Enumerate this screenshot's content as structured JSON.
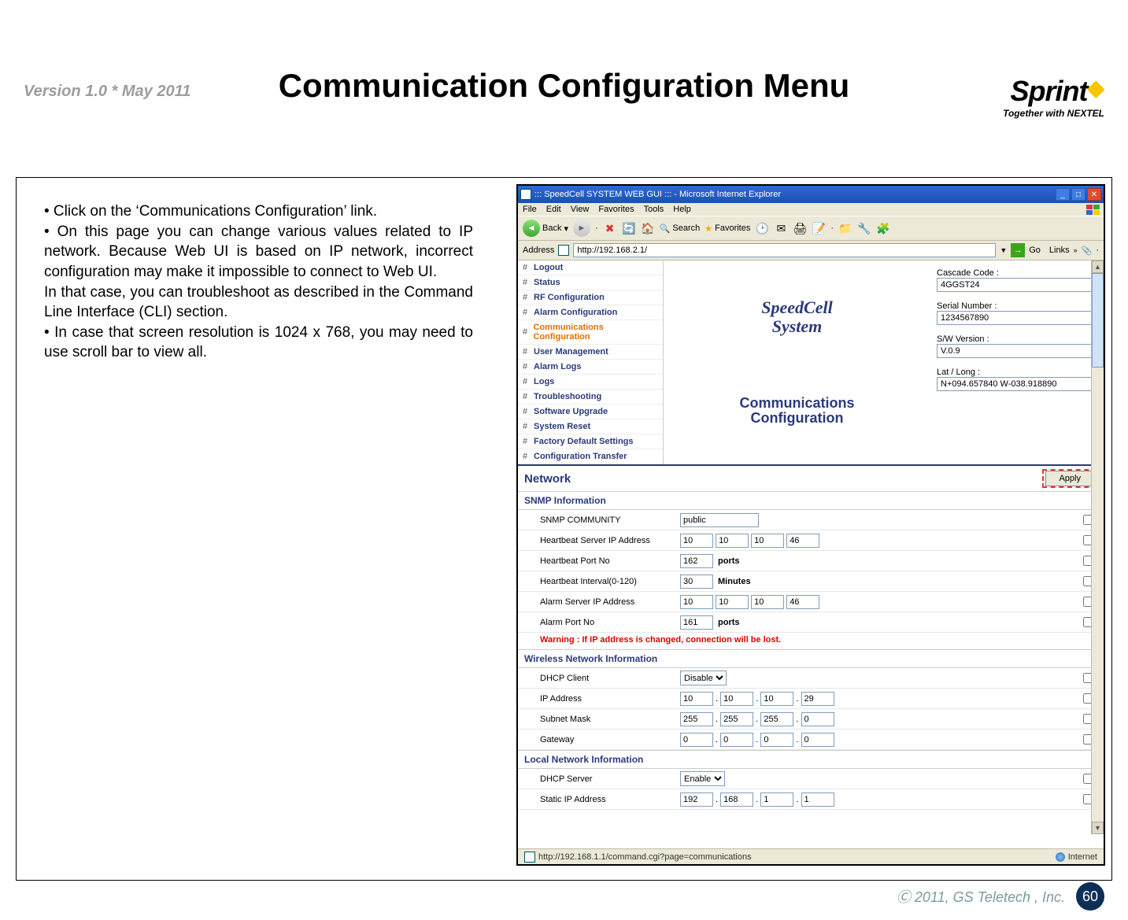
{
  "doc": {
    "version": "Version 1.0 * May 2011",
    "logo_main": "Sprint",
    "logo_sub_prefix": "Together with ",
    "logo_sub_brand": "NEXTEL",
    "title": "Communication Configuration Menu",
    "bullets_html": "• Click on the ‘Communications Configuration’ link.\n• On this page you can change various values related to IP network. Because Web UI is based on IP network, incorrect configuration may make it impossible to connect to Web UI.\nIn that case, you can troubleshoot as described in the Command Line Interface (CLI) section.\n• In case that screen resolution is 1024 x 768, you may need to use scroll bar to view all.",
    "footer_copy": "Ⓒ 2011, GS Teletech , Inc.",
    "page_number": "60"
  },
  "ie": {
    "title": "::: SpeedCell SYSTEM WEB GUI ::: - Microsoft Internet Explorer",
    "menus": [
      "File",
      "Edit",
      "View",
      "Favorites",
      "Tools",
      "Help"
    ],
    "back_label": "Back",
    "search_label": "Search",
    "fav_label": "Favorites",
    "address_label": "Address",
    "address_value": "http://192.168.2.1/",
    "go_label": "Go",
    "links_label": "Links",
    "status_url": "http://192.168.1.1/command.cgi?page=communications",
    "status_zone": "Internet"
  },
  "nav": {
    "items": [
      {
        "label": "Logout"
      },
      {
        "label": "Status"
      },
      {
        "label": "RF Configuration"
      },
      {
        "label": "Alarm Configuration"
      },
      {
        "label": "Communications Configuration",
        "active": true
      },
      {
        "label": "User Management"
      },
      {
        "label": "Alarm Logs"
      },
      {
        "label": "Logs"
      },
      {
        "label": "Troubleshooting"
      },
      {
        "label": "Software Upgrade"
      },
      {
        "label": "System Reset"
      },
      {
        "label": "Factory Default Settings"
      },
      {
        "label": "Configuration Transfer"
      }
    ]
  },
  "center": {
    "brand_l1": "SpeedCell",
    "brand_l2": "System",
    "page_l1": "Communications",
    "page_l2": "Configuration"
  },
  "right": {
    "cascade_label": "Cascade Code :",
    "cascade_value": "4GGST24",
    "serial_label": "Serial Number :",
    "serial_value": "1234567890",
    "sw_label": "S/W Version :",
    "sw_value": "V.0.9",
    "latlon_label": "Lat / Long :",
    "latlon_value": "N+094.657840 W-038.918890"
  },
  "network": {
    "title": "Network",
    "apply": "Apply",
    "snmp_head": "SNMP Information",
    "snmp_community_label": "SNMP COMMUNITY",
    "snmp_community_value": "public",
    "hb_ip_label": "Heartbeat Server IP Address",
    "hb_ip": [
      "10",
      "10",
      "10",
      "46"
    ],
    "hb_port_label": "Heartbeat Port No",
    "hb_port_value": "162",
    "ports_unit": "ports",
    "hb_int_label": "Heartbeat Interval(0-120)",
    "hb_int_value": "30",
    "minutes_unit": "Minutes",
    "alarm_ip_label": "Alarm Server IP Address",
    "alarm_ip": [
      "10",
      "10",
      "10",
      "46"
    ],
    "alarm_port_label": "Alarm Port No",
    "alarm_port_value": "161",
    "warning": "Warning : If IP address is changed, connection will be lost.",
    "wireless_head": "Wireless Network Information",
    "dhcp_client_label": "DHCP Client",
    "dhcp_client_value": "Disable",
    "ip_label": "IP Address",
    "ip": [
      "10",
      "10",
      "10",
      "29"
    ],
    "subnet_label": "Subnet Mask",
    "subnet": [
      "255",
      "255",
      "255",
      "0"
    ],
    "gateway_label": "Gateway",
    "gateway": [
      "0",
      "0",
      "0",
      "0"
    ],
    "local_head": "Local Network Information",
    "dhcp_server_label": "DHCP Server",
    "dhcp_server_value": "Enable",
    "static_ip_label": "Static IP Address",
    "static_ip": [
      "192",
      "168",
      "1",
      "1"
    ]
  }
}
